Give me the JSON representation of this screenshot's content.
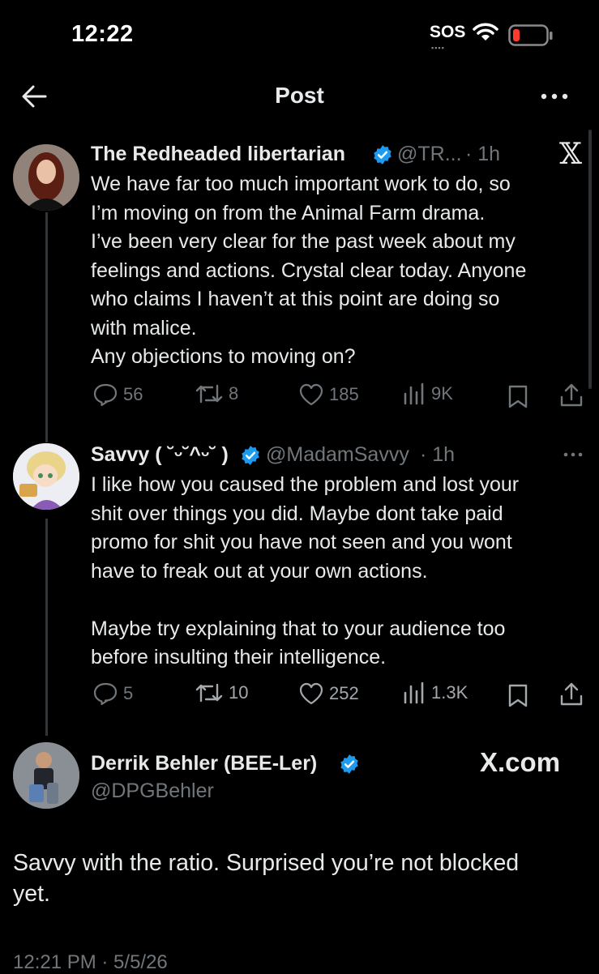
{
  "status_bar": {
    "time": "12:22",
    "sos": "SOS"
  },
  "header": {
    "title": "Post"
  },
  "tweets": [
    {
      "name": "The Redheaded libertarian",
      "handle": "@TR...",
      "time": "· 1h",
      "text": "We have far too much important work to do, so\nI’m moving on from the Animal Farm drama.\nI’ve been very clear for the past week about my\nfeelings and actions. Crystal clear today. Anyone\nwho claims I haven’t at this point are doing so\nwith malice.\nAny objections to moving on?",
      "replies": "56",
      "reposts": "8",
      "likes": "185",
      "views": "9K"
    },
    {
      "name": "Savvy ( ˘ᵕ˘^ᵕ˘ )",
      "handle": "@MadamSavvy",
      "time": "· 1h",
      "text": "I like how you caused the problem and lost your\nshit over things you did. Maybe dont take paid\npromo for shit you have not seen and you wont\nhave to freak out at your own actions.\n\nMaybe try explaining that to your audience too\nbefore insulting their intelligence.",
      "replies": "5",
      "reposts": "10",
      "likes": "252",
      "views": "1.3K"
    }
  ],
  "main_post": {
    "name": "Derrik Behler (BEE-Ler)",
    "handle": "@DPGBehler",
    "brand": "X.com",
    "text": "Savvy with the ratio. Surprised you’re not blocked\nyet.",
    "timestamp": "12:21 PM · 5/5/26"
  },
  "colors": {
    "accent": "#1d9bf0",
    "muted": "#71767b",
    "text": "#e7e9ea",
    "background": "#000000"
  },
  "icons": [
    "back-arrow-icon",
    "more-icon",
    "x-logo-icon",
    "reply-icon",
    "repost-icon",
    "like-icon",
    "views-icon",
    "bookmark-icon",
    "share-icon",
    "verified-icon",
    "wifi-icon",
    "battery-icon"
  ]
}
